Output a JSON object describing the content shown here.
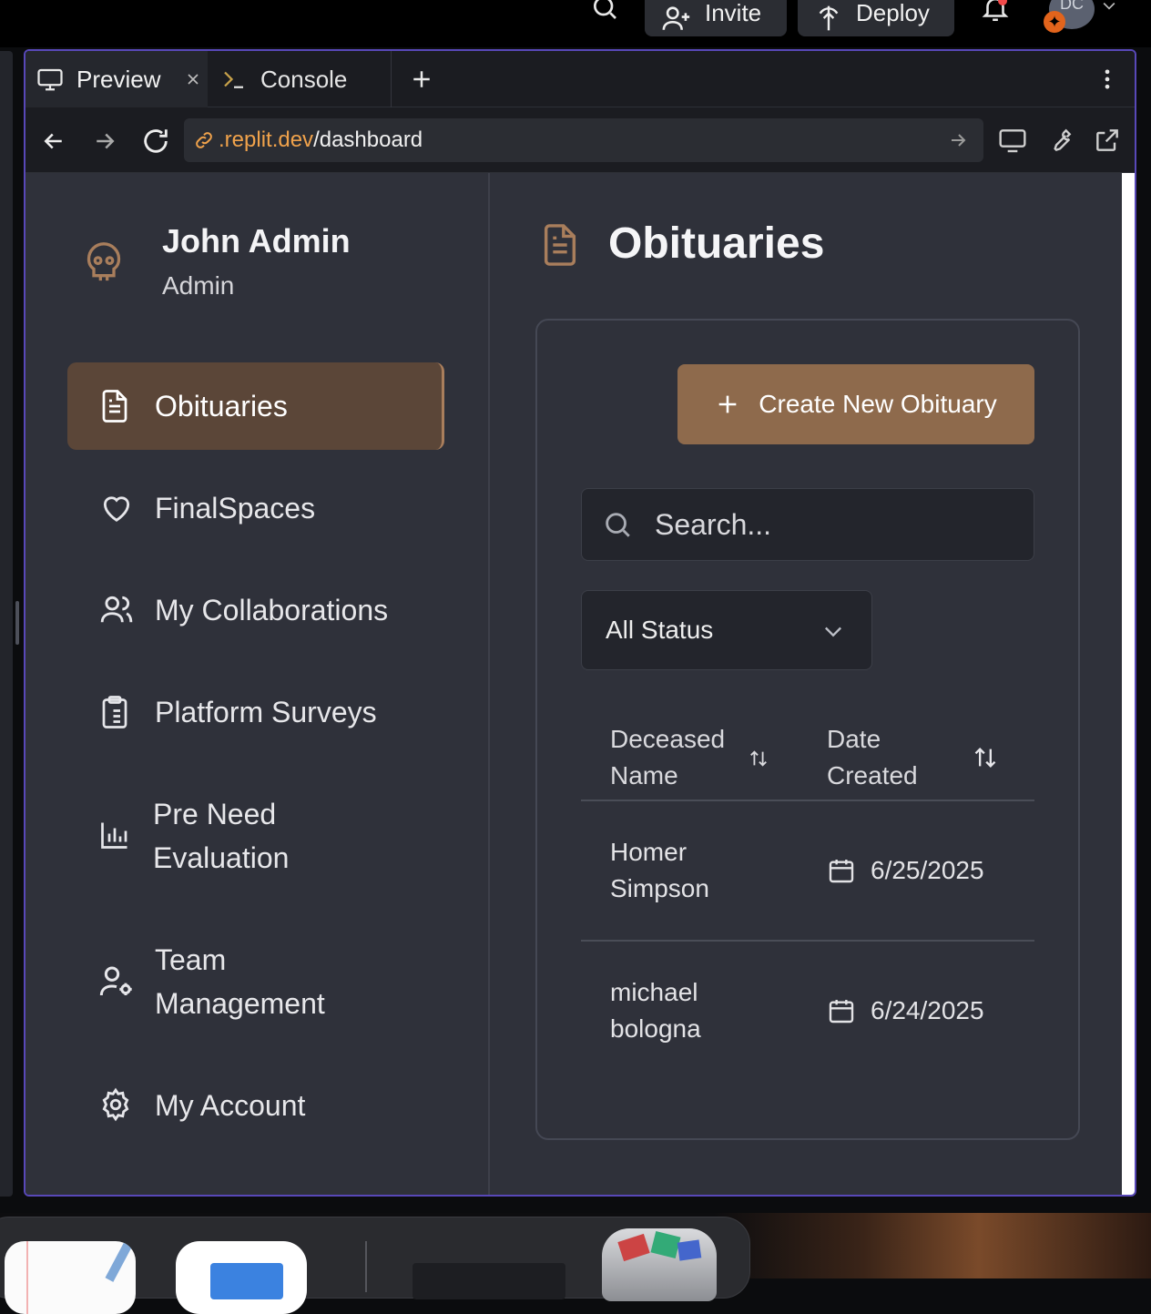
{
  "topbar": {
    "invite_label": "Invite",
    "deploy_label": "Deploy",
    "avatar_initials": "DC"
  },
  "browser": {
    "tabs": [
      {
        "label": "Preview"
      },
      {
        "label": "Console"
      }
    ],
    "url": {
      "host": ".replit.dev",
      "path": "/dashboard"
    }
  },
  "sidebar": {
    "user_name": "John Admin",
    "user_role": "Admin",
    "items": [
      {
        "label": "Obituaries",
        "icon": "file-text-icon",
        "active": true
      },
      {
        "label": "FinalSpaces",
        "icon": "heart-icon"
      },
      {
        "label": "My Collaborations",
        "icon": "users-icon"
      },
      {
        "label": "Platform Surveys",
        "icon": "clipboard-list-icon"
      },
      {
        "label": "Pre Need Evaluation",
        "icon": "bar-chart-icon"
      },
      {
        "label": "Team Management",
        "icon": "user-cog-icon"
      },
      {
        "label": "My Account",
        "icon": "gear-icon"
      }
    ]
  },
  "main": {
    "title": "Obituaries",
    "create_button_label": "Create New Obituary",
    "search_placeholder": "Search...",
    "status_filter": "All Status",
    "table": {
      "columns": [
        "Deceased Name",
        "Date Created"
      ],
      "rows": [
        {
          "name": "Homer Simpson",
          "date": "6/25/2025"
        },
        {
          "name": "michael bologna",
          "date": "6/24/2025"
        }
      ]
    }
  },
  "colors": {
    "accent": "#8e6a4c",
    "active_nav": "#5b4638",
    "icon_brown": "#a97e5c",
    "url_host": "#f0a24b",
    "window_border": "#5848b8"
  }
}
